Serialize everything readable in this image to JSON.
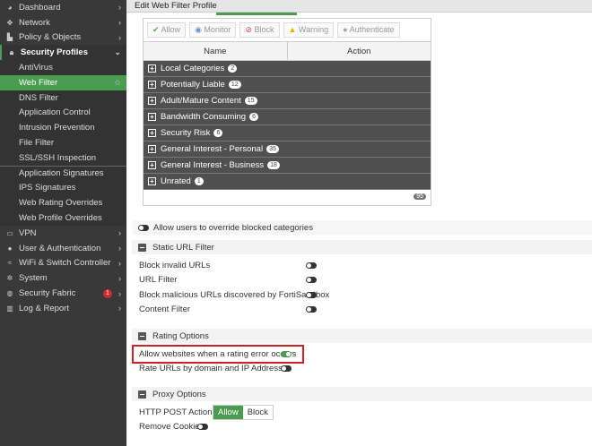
{
  "sidebar": {
    "items": [
      {
        "label": "Dashboard",
        "icon": "dashboard-icon"
      },
      {
        "label": "Network",
        "icon": "network-icon"
      },
      {
        "label": "Policy & Objects",
        "icon": "policy-icon"
      },
      {
        "label": "Security Profiles",
        "icon": "lock-icon"
      },
      {
        "label": "AntiVirus"
      },
      {
        "label": "Web Filter"
      },
      {
        "label": "DNS Filter"
      },
      {
        "label": "Application Control"
      },
      {
        "label": "Intrusion Prevention"
      },
      {
        "label": "File Filter"
      },
      {
        "label": "SSL/SSH Inspection"
      },
      {
        "label": "Application Signatures"
      },
      {
        "label": "IPS Signatures"
      },
      {
        "label": "Web Rating Overrides"
      },
      {
        "label": "Web Profile Overrides"
      },
      {
        "label": "VPN",
        "icon": "laptop-icon"
      },
      {
        "label": "User & Authentication",
        "icon": "user-icon"
      },
      {
        "label": "WiFi & Switch Controller",
        "icon": "wifi-icon"
      },
      {
        "label": "System",
        "icon": "gear-icon"
      },
      {
        "label": "Security Fabric",
        "icon": "fabric-icon",
        "badge": "1"
      },
      {
        "label": "Log & Report",
        "icon": "chart-icon"
      }
    ]
  },
  "header": {
    "title": "Edit Web Filter Profile"
  },
  "filters": [
    "Allow",
    "Monitor",
    "Block",
    "Warning",
    "Authenticate"
  ],
  "table": {
    "columns": [
      "Name",
      "Action"
    ],
    "rows": [
      {
        "name": "Local Categories",
        "count": "2"
      },
      {
        "name": "Potentially Liable",
        "count": "12"
      },
      {
        "name": "Adult/Mature Content",
        "count": "15"
      },
      {
        "name": "Bandwidth Consuming",
        "count": "6"
      },
      {
        "name": "Security Risk",
        "count": "6"
      },
      {
        "name": "General Interest - Personal",
        "count": "35"
      },
      {
        "name": "General Interest - Business",
        "count": "18"
      },
      {
        "name": "Unrated",
        "count": "1"
      }
    ],
    "total": "95"
  },
  "override": "Allow users to override blocked categories",
  "static": {
    "title": "Static URL Filter",
    "options": [
      "Block invalid URLs",
      "URL Filter",
      "Block malicious URLs discovered by FortiSandbox",
      "Content Filter"
    ]
  },
  "rating": {
    "title": "Rating Options",
    "options": [
      "Allow websites when a rating error occurs",
      "Rate URLs by domain and IP Address"
    ],
    "states": [
      true,
      false
    ]
  },
  "proxy": {
    "title": "Proxy Options",
    "http_post": "HTTP POST Action",
    "allow": "Allow",
    "block": "Block",
    "cookies": "Remove Cookies"
  },
  "colors": {
    "accent": "#4a9c51",
    "highlight": "#d0202a"
  }
}
